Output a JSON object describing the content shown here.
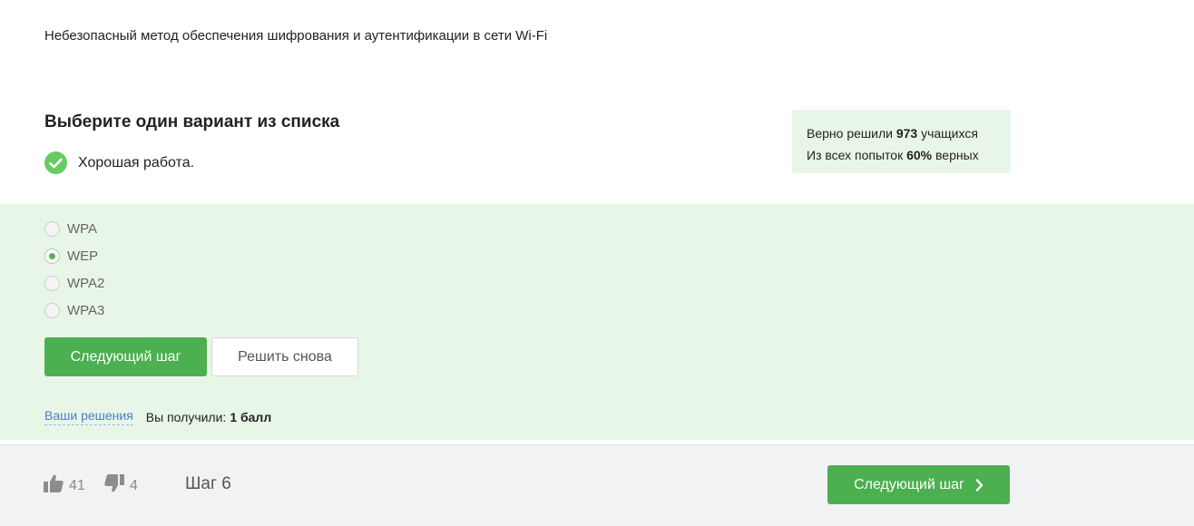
{
  "question": {
    "text": "Небезопасный метод обеспечения шифрования и аутентификации в сети Wi-Fi"
  },
  "quiz": {
    "title": "Выберите один вариант из списка",
    "feedback": "Хорошая работа."
  },
  "stats": {
    "solved_prefix": "Верно решили",
    "solved_count": "973",
    "solved_suffix": "учащихся",
    "attempts_prefix": "Из всех попыток",
    "attempts_percent": "60%",
    "attempts_suffix": "верных"
  },
  "options": [
    {
      "label": "WPA",
      "selected": false
    },
    {
      "label": "WEP",
      "selected": true
    },
    {
      "label": "WPA2",
      "selected": false
    },
    {
      "label": "WPA3",
      "selected": false
    }
  ],
  "buttons": {
    "next_step": "Следующий шаг",
    "retry": "Решить снова"
  },
  "result": {
    "solutions_link": "Ваши решения",
    "score_label": "Вы получили:",
    "score_value": "1 балл"
  },
  "footer": {
    "likes": "41",
    "dislikes": "4",
    "step": "Шаг 6",
    "next_step": "Следующий шаг"
  },
  "colors": {
    "accent_green": "#4caf50",
    "panel_green": "#e8f6e8",
    "check_green": "#66cc66",
    "link_blue": "#4a7fc7"
  },
  "icons": {
    "feedback": "check-circle-icon",
    "like": "thumbs-up-icon",
    "dislike": "thumbs-down-icon",
    "next": "chevron-right-icon"
  }
}
